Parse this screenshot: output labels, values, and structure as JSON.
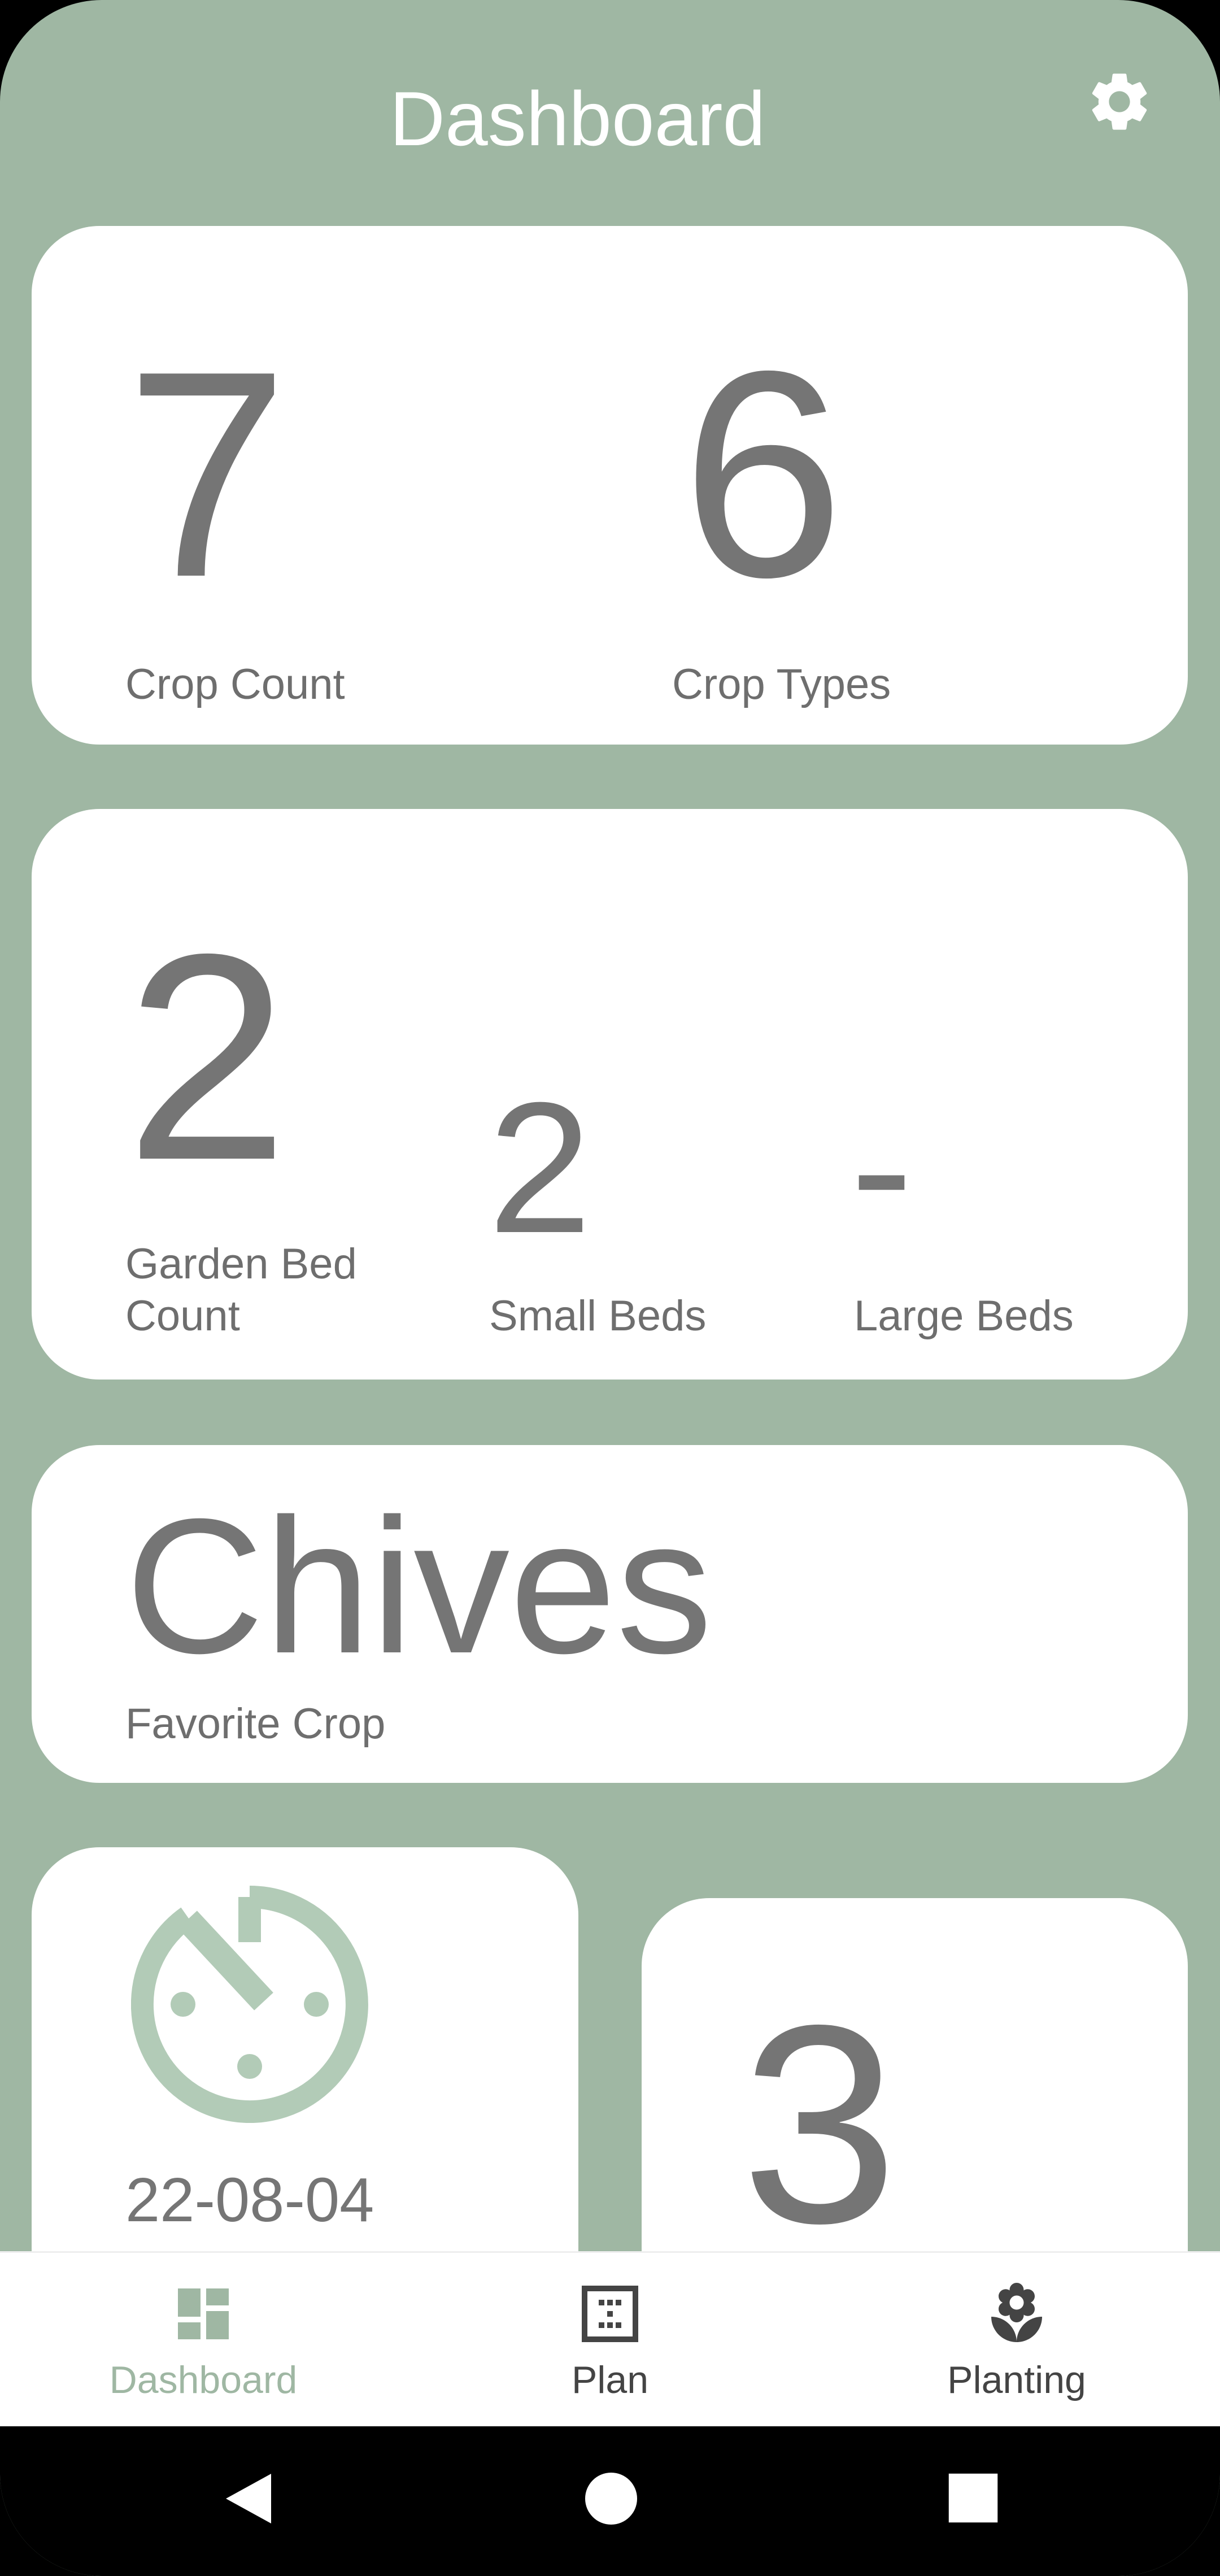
{
  "header": {
    "title": "Dashboard",
    "settings_icon": "gear-icon"
  },
  "crops_card": {
    "crop_count": "7",
    "crop_count_label": "Crop Count",
    "crop_types": "6",
    "crop_types_label": "Crop Types"
  },
  "beds_card": {
    "garden_bed_count": "2",
    "garden_bed_count_label_line1": "Garden Bed",
    "garden_bed_count_label_line2": "Count",
    "small_beds": "2",
    "small_beds_label": "Small Beds",
    "large_beds": "-",
    "large_beds_label": "Large Beds"
  },
  "favorite_card": {
    "favorite_crop": "Chives",
    "favorite_crop_label": "Favorite Crop"
  },
  "timer_card": {
    "date": "22-08-04",
    "icon": "clock-icon"
  },
  "count_card": {
    "value": "3"
  },
  "bottom_nav": {
    "items": [
      {
        "label": "Dashboard",
        "icon": "dashboard-icon",
        "active": true
      },
      {
        "label": "Plan",
        "icon": "grid-plan-icon",
        "active": false
      },
      {
        "label": "Planting",
        "icon": "flower-icon",
        "active": false
      }
    ]
  },
  "colors": {
    "accent": "#9FB7A3",
    "icon_tint": "#B2CBB7",
    "text": "#757575"
  },
  "system_nav": {
    "icons": [
      "back-icon",
      "home-icon",
      "recents-icon"
    ]
  }
}
